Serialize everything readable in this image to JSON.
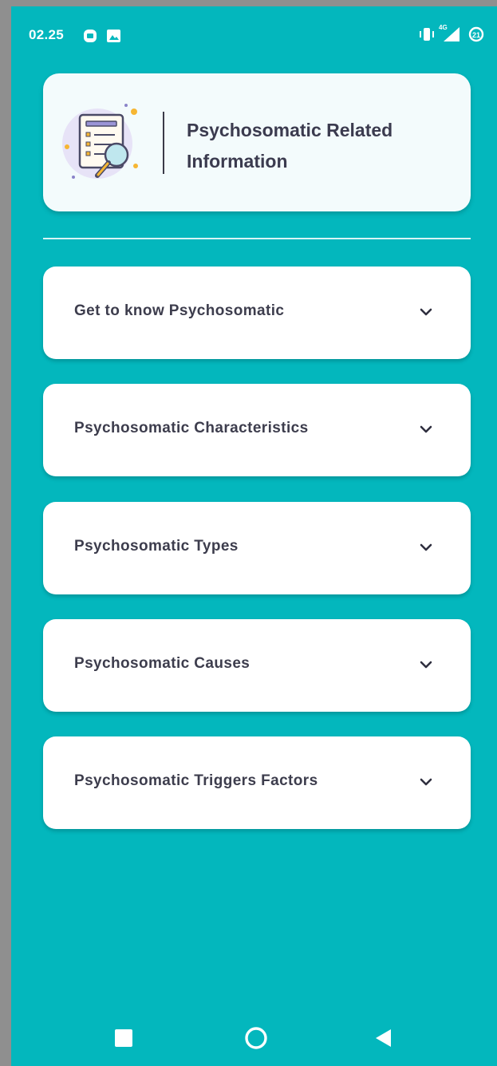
{
  "status_bar": {
    "time": "02.25",
    "icons": [
      "notification-app-icon",
      "image-icon",
      "vibrate-icon",
      "4g-signal-icon",
      "battery-saver-icon"
    ],
    "signal_label": "4G"
  },
  "header": {
    "title": "Psychosomatic Related Information",
    "illustration": "document-magnifier-illustration"
  },
  "accordion": [
    {
      "label": "Get to know Psychosomatic",
      "icon": "chevron-down-icon"
    },
    {
      "label": "Psychosomatic Characteristics",
      "icon": "chevron-down-icon"
    },
    {
      "label": "Psychosomatic Types",
      "icon": "chevron-down-icon"
    },
    {
      "label": "Psychosomatic Causes",
      "icon": "chevron-down-icon"
    },
    {
      "label": "Psychosomatic Triggers Factors",
      "icon": "chevron-down-icon"
    }
  ],
  "nav_bar": {
    "buttons": [
      "recents-square-icon",
      "home-circle-icon",
      "back-triangle-icon"
    ]
  },
  "colors": {
    "background": "#03b7bd",
    "card": "#ffffff",
    "header_card": "#f3fbfc",
    "text": "#3d3d4d"
  }
}
